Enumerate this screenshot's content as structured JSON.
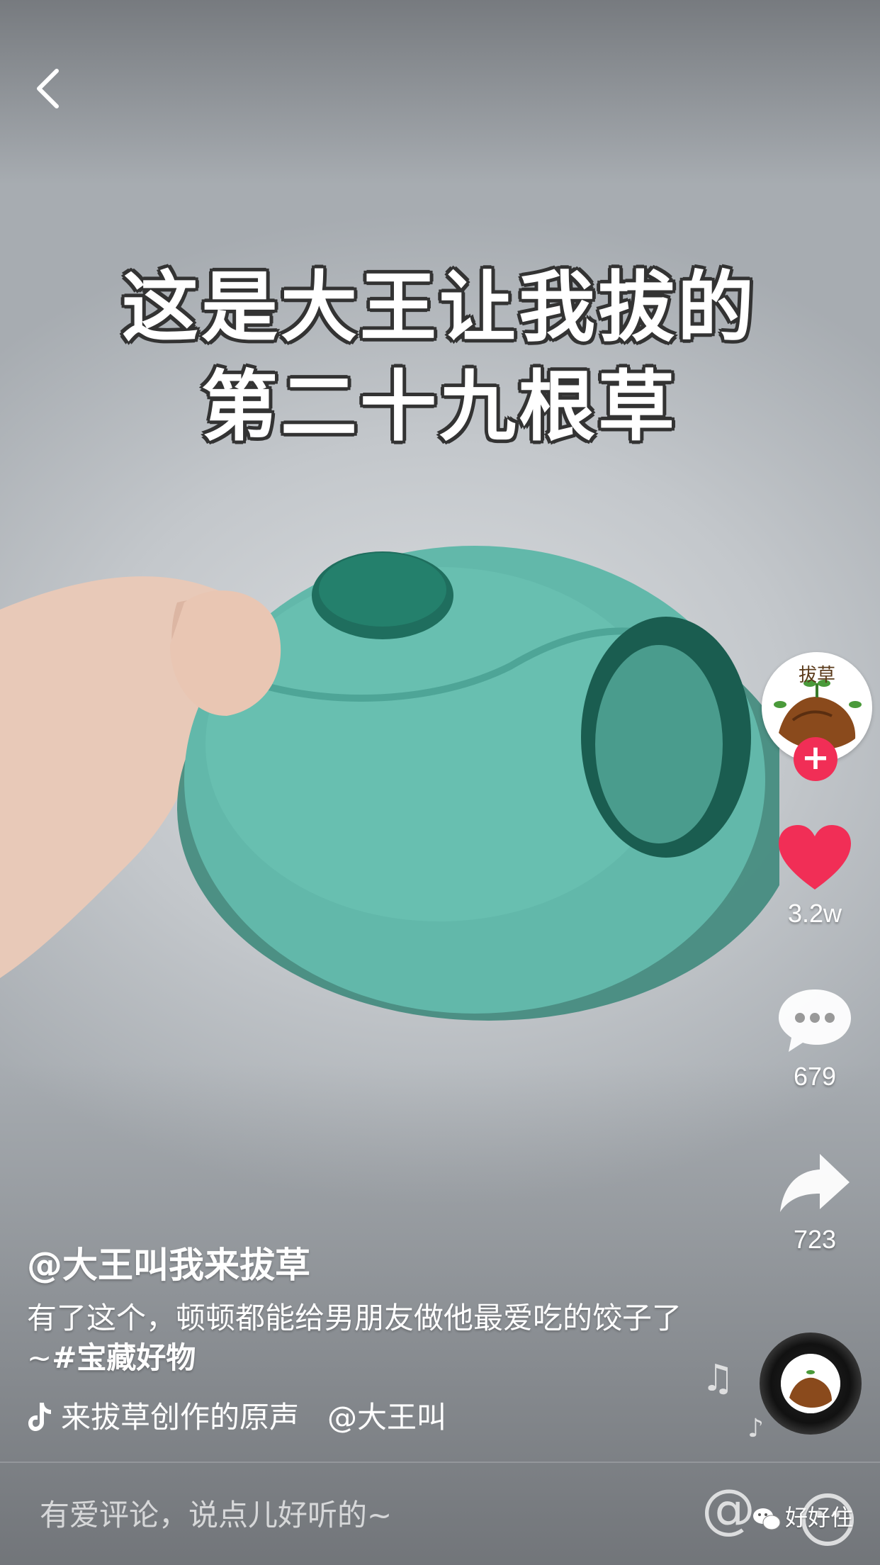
{
  "video": {
    "caption_line1": "这是大王让我拔的",
    "caption_line2": "第二十九根草"
  },
  "creator": {
    "avatar_text": "拔草",
    "follow_label": "+"
  },
  "actions": {
    "likes": "3.2w",
    "comments": "679",
    "shares": "723"
  },
  "post": {
    "author": "@大王叫我来拔草",
    "description": "有了这个，顿顿都能给男朋友做他最爱吃的饺子了~",
    "hashtag": "#宝藏好物",
    "music_text_1": "来拔草创作的原声",
    "music_text_2": "@大王叫"
  },
  "comment_bar": {
    "placeholder": "有爱评论，说点儿好听的~",
    "at_symbol": "@"
  },
  "watermark": "好好住",
  "colors": {
    "like_red": "#f12e56",
    "product_teal": "#5fb6a8",
    "product_dark_teal": "#1f6e5e"
  },
  "icons": [
    "back-icon",
    "heart-icon",
    "comment-bubble-icon",
    "share-arrow-icon",
    "tiktok-note-icon",
    "music-note-icon",
    "at-icon",
    "emoji-icon",
    "wechat-icon"
  ]
}
